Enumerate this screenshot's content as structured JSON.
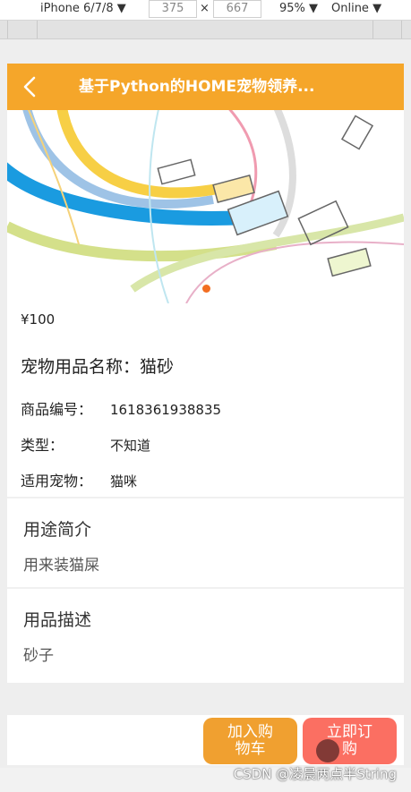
{
  "devtools": {
    "device": "iPhone 6/7/8 ▼",
    "width": "375",
    "times": "×",
    "height": "667",
    "zoom": "95% ▼",
    "network": "Online ▼"
  },
  "header": {
    "title": "基于Python的HOME宠物领养..."
  },
  "banner": {
    "slide_count": 1,
    "active_index": 0
  },
  "product": {
    "price": "¥100",
    "name_line": "宠物用品名称：猫砂",
    "fields": [
      {
        "label": "商品编号：",
        "value": "1618361938835"
      },
      {
        "label": "类型：",
        "value": "不知道"
      },
      {
        "label": "适用宠物：",
        "value": "猫咪"
      }
    ]
  },
  "sections": [
    {
      "title": "用途简介",
      "text": "用来装猫屎"
    },
    {
      "title": "用品描述",
      "text": "砂子"
    }
  ],
  "actions": {
    "add_cart": "加入购物车",
    "order_now": "立即订购"
  },
  "watermark": "CSDN @凌晨两点半String",
  "colors": {
    "accent": "#f5a62a",
    "cart": "#f0a030",
    "order": "#fb6f62",
    "dot": "#f26d21"
  }
}
